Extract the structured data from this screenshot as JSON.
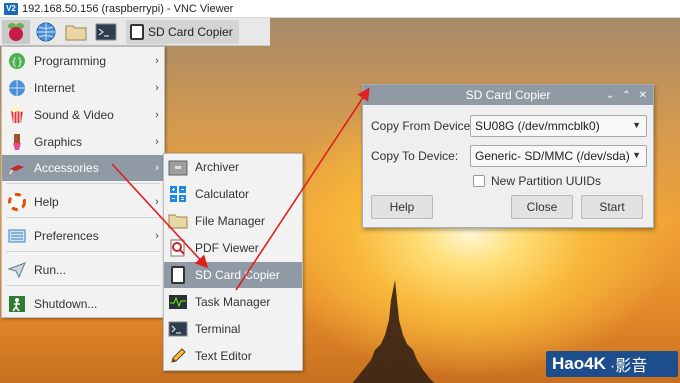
{
  "window": {
    "logo": "V2",
    "title": "192.168.50.156 (raspberrypi) - VNC Viewer"
  },
  "taskbar": {
    "icons": [
      "raspberry-icon",
      "globe-icon",
      "folder-icon",
      "terminal-icon"
    ],
    "task_label": "SD Card Copier"
  },
  "menu": {
    "items": [
      {
        "label": "Programming",
        "icon": "code-braces-icon"
      },
      {
        "label": "Internet",
        "icon": "globe-icon"
      },
      {
        "label": "Sound & Video",
        "icon": "popcorn-icon"
      },
      {
        "label": "Graphics",
        "icon": "paintbrush-icon"
      },
      {
        "label": "Accessories",
        "icon": "swiss-knife-icon"
      },
      {
        "label": "Help",
        "icon": "lifebuoy-icon"
      },
      {
        "label": "Preferences",
        "icon": "settings-panel-icon"
      },
      {
        "label": "Run...",
        "icon": "paper-plane-icon"
      },
      {
        "label": "Shutdown...",
        "icon": "exit-icon"
      }
    ]
  },
  "submenu": {
    "items": [
      {
        "label": "Archiver",
        "icon": "archive-icon"
      },
      {
        "label": "Calculator",
        "icon": "calculator-icon"
      },
      {
        "label": "File Manager",
        "icon": "folder-icon"
      },
      {
        "label": "PDF Viewer",
        "icon": "pdf-viewer-icon"
      },
      {
        "label": "SD Card Copier",
        "icon": "sd-card-icon"
      },
      {
        "label": "Task Manager",
        "icon": "task-manager-icon"
      },
      {
        "label": "Terminal",
        "icon": "terminal-icon"
      },
      {
        "label": "Text Editor",
        "icon": "pencil-icon"
      }
    ]
  },
  "dialog": {
    "title": "SD Card Copier",
    "copy_from_label": "Copy From Device:",
    "copy_from_value": "SU08G  (/dev/mmcblk0)",
    "copy_to_label": "Copy To Device:",
    "copy_to_value": "Generic- SD/MMC  (/dev/sda)",
    "new_partition_label": "New Partition UUIDs",
    "new_partition_checked": false,
    "help_button": "Help",
    "close_button": "Close",
    "start_button": "Start"
  },
  "watermark": {
    "brand": "Hao4K",
    "suffix": "·影音"
  },
  "colors": {
    "highlight": "#8f9aa4",
    "arrow": "#e02020",
    "watermark": "#1e4d8e"
  }
}
